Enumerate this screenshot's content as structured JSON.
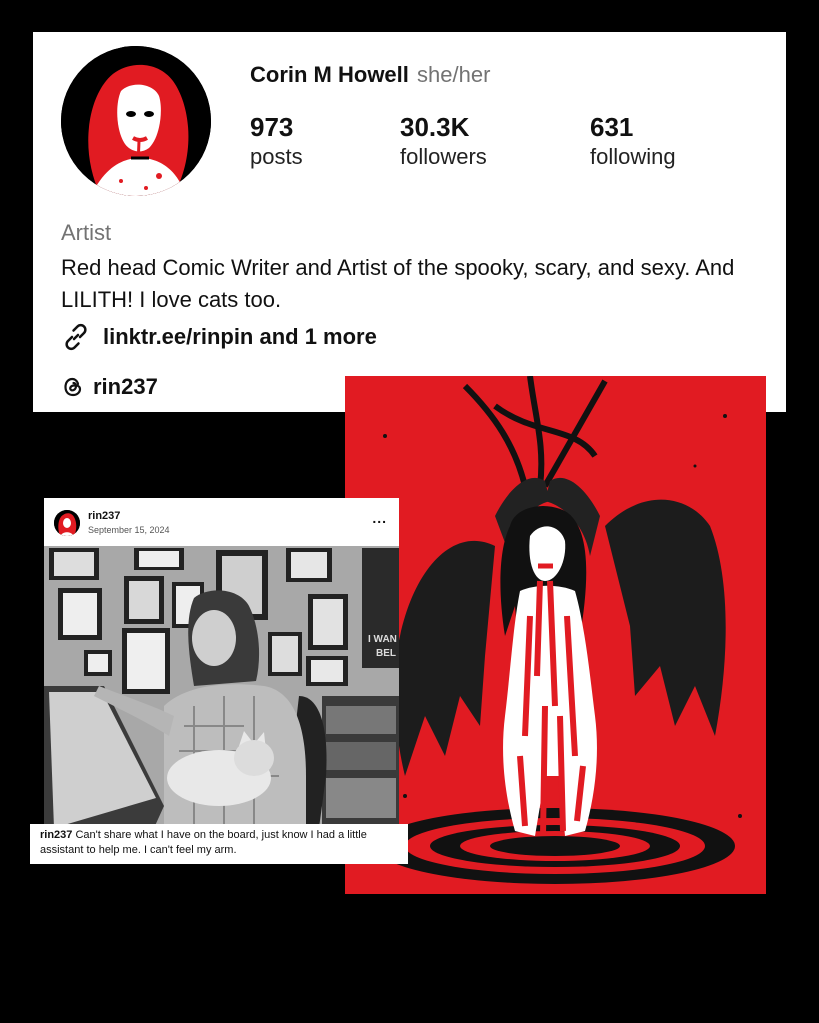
{
  "profile": {
    "name": "Corin M Howell",
    "pronouns": "she/her",
    "stats": [
      {
        "value": "973",
        "label": "posts"
      },
      {
        "value": "30.3K",
        "label": "followers"
      },
      {
        "value": "631",
        "label": "following"
      }
    ],
    "category": "Artist",
    "bio": "Red head Comic Writer and Artist of the spooky, scary, and sexy. And LILITH! I love cats too.",
    "link": "linktr.ee/rinpin and 1 more",
    "threads_handle": "rin237"
  },
  "post": {
    "username": "rin237",
    "date": "September 15, 2024",
    "more": "...",
    "caption_user": "rin237",
    "caption_text": "Can't share what I have on the board, just know I had a little assistant to help me. I can't feel my arm.",
    "poster_text_1": "I WAN",
    "poster_text_2": "BEL"
  },
  "colors": {
    "accent_red": "#e11b22",
    "background": "#000000",
    "muted_text": "#737373"
  },
  "icons": {
    "link": "link-icon",
    "threads": "threads-icon",
    "more": "more-options-icon"
  }
}
